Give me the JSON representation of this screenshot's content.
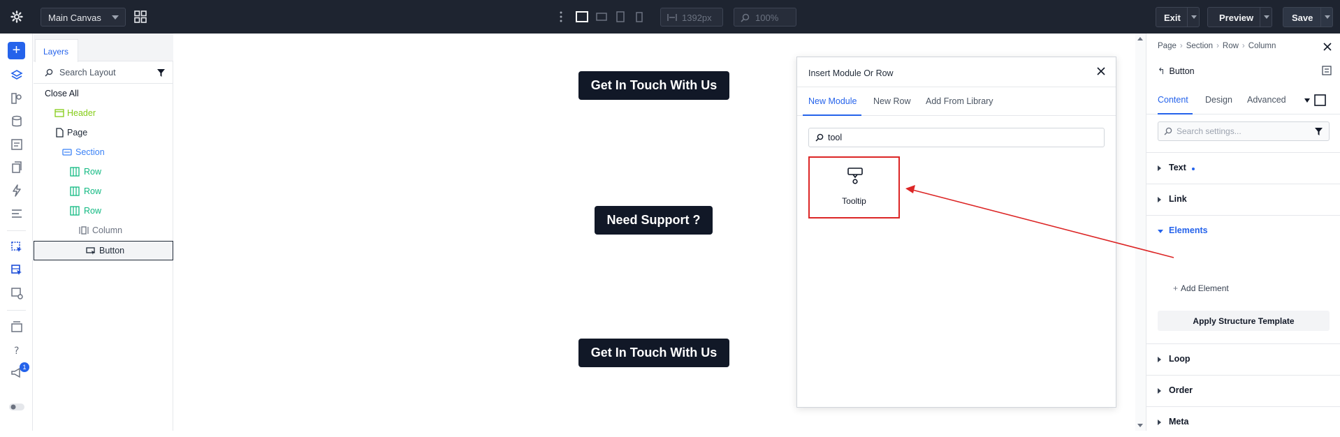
{
  "topbar": {
    "canvas_select": "Main Canvas",
    "width_value": "1392px",
    "zoom_value": "100%",
    "exit_label": "Exit",
    "preview_label": "Preview",
    "save_label": "Save"
  },
  "left_rail": {
    "notification_count": "1"
  },
  "layers": {
    "tab_label": "Layers",
    "search_placeholder": "Search Layout",
    "close_all": "Close All",
    "items": [
      {
        "label": "Header",
        "color": "#84cc16"
      },
      {
        "label": "Page",
        "color": "#1f2937"
      },
      {
        "label": "Section",
        "color": "#3b82f6"
      },
      {
        "label": "Row",
        "color": "#10b981"
      },
      {
        "label": "Row",
        "color": "#10b981"
      },
      {
        "label": "Row",
        "color": "#10b981"
      },
      {
        "label": "Column",
        "color": "#6b7280"
      },
      {
        "label": "Button",
        "color": "#1f2937"
      }
    ]
  },
  "canvas": {
    "cta_top": "Get In Touch With Us",
    "cta_middle": "Need Support ?",
    "cta_bottom": "Get In Touch With Us"
  },
  "modal": {
    "title": "Insert Module Or Row",
    "tabs": [
      "New Module",
      "New Row",
      "Add From Library"
    ],
    "search_value": "tool",
    "module_label": "Tooltip"
  },
  "settings": {
    "breadcrumb": [
      "Page",
      "Section",
      "Row",
      "Column"
    ],
    "title": "Button",
    "tabs": [
      "Content",
      "Design",
      "Advanced"
    ],
    "search_placeholder": "Search settings...",
    "groups": {
      "text": "Text",
      "link": "Link",
      "elements": "Elements",
      "loop": "Loop",
      "order": "Order",
      "meta": "Meta"
    },
    "add_element": "Add Element",
    "apply_template": "Apply Structure Template"
  },
  "colors": {
    "accent": "#2563eb",
    "highlight": "#dc2626",
    "topbar": "#1e2430",
    "cta": "#111827"
  }
}
